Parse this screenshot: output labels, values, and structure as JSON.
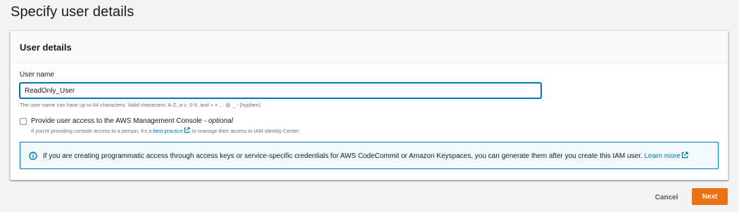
{
  "page": {
    "title": "Specify user details"
  },
  "panel": {
    "title": "User details",
    "user_name": {
      "label": "User name",
      "value": "ReadOnly_User",
      "constraint": "The user name can have up to 64 characters. Valid characters: A-Z, a-z, 0-9, and + = , . @ _ - (hyphen)"
    },
    "console_access": {
      "checked": false,
      "label": "Provide user access to the AWS Management Console - ",
      "label_optional": "optional",
      "desc_before": "If you're providing console access to a person, it's a ",
      "desc_link": "best practice",
      "desc_after": " to manage their access in IAM Identity Center."
    },
    "alert": {
      "icon": "info-icon",
      "text": "If you are creating programmatic access through access keys or service-specific credentials for AWS CodeCommit or Amazon Keyspaces, you can generate them after you create this IAM user. ",
      "link": "Learn more"
    }
  },
  "footer": {
    "cancel_label": "Cancel",
    "next_label": "Next"
  },
  "colors": {
    "primary_button": "#ec7211",
    "link": "#0073bb",
    "alert_bg": "#f1faff",
    "focus_border": "#0073bb"
  }
}
